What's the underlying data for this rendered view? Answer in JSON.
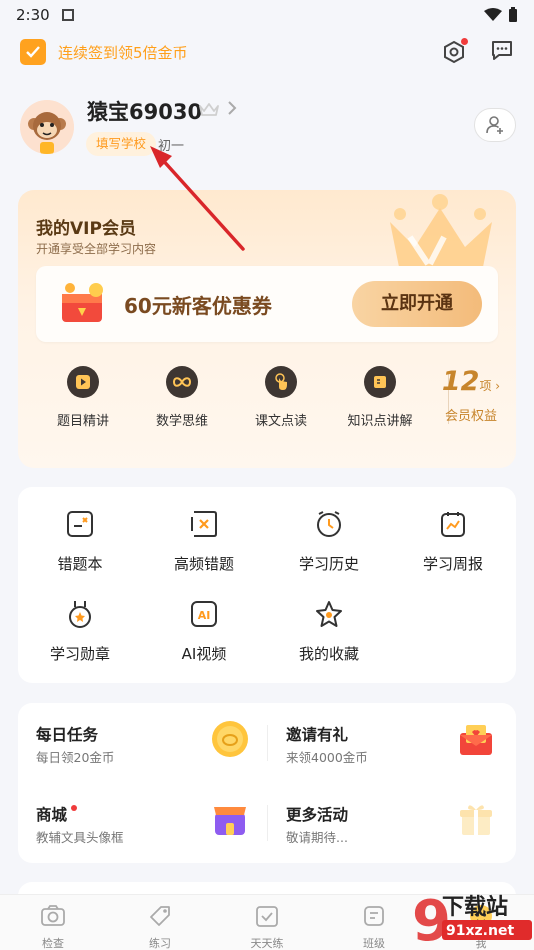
{
  "status_bar": {
    "time": "2:30"
  },
  "top_bar": {
    "checkin_text": "连续签到领5倍金币"
  },
  "profile": {
    "username": "猿宝69030",
    "school_tag": "填写学校",
    "grade": "初一"
  },
  "vip": {
    "title": "我的VIP会员",
    "subtitle": "开通享受全部学习内容",
    "coupon_text": "60元新客优惠券",
    "open_button": "立即开通",
    "features": [
      {
        "label": "题目精讲",
        "icon": "play-icon"
      },
      {
        "label": "数学思维",
        "icon": "infinity-icon"
      },
      {
        "label": "课文点读",
        "icon": "finger-tap-icon"
      },
      {
        "label": "知识点讲解",
        "icon": "book-icon"
      }
    ],
    "benefits": {
      "count": "12",
      "unit": "项",
      "label": "会员权益"
    }
  },
  "tools": [
    {
      "label": "错题本",
      "icon": "wrong-book-icon"
    },
    {
      "label": "高频错题",
      "icon": "frequent-errors-icon"
    },
    {
      "label": "学习历史",
      "icon": "clock-icon"
    },
    {
      "label": "学习周报",
      "icon": "weekly-report-icon"
    },
    {
      "label": "学习勋章",
      "icon": "medal-icon"
    },
    {
      "label": "AI视频",
      "icon": "ai-video-icon"
    },
    {
      "label": "我的收藏",
      "icon": "star-icon"
    }
  ],
  "tasks": [
    {
      "title": "每日任务",
      "subtitle": "每日领20金币",
      "icon": "coin-icon"
    },
    {
      "title": "邀请有礼",
      "subtitle": "来领4000金币",
      "icon": "invite-envelope-icon"
    },
    {
      "title": "商城",
      "subtitle": "教辅文具头像框",
      "icon": "shop-icon"
    },
    {
      "title": "更多活动",
      "subtitle": "敬请期待...",
      "icon": "gift-box-icon"
    }
  ],
  "tab_bar": [
    {
      "label": "检查",
      "icon": "camera-icon"
    },
    {
      "label": "练习",
      "icon": "tag-icon"
    },
    {
      "label": "天天练",
      "icon": "calendar-check-icon"
    },
    {
      "label": "班级",
      "icon": "class-icon"
    },
    {
      "label": "我",
      "icon": "profile-icon"
    }
  ],
  "watermark": {
    "line1": "下载站",
    "line2": "91xz.net"
  },
  "colors": {
    "accent": "#ff9f1a",
    "vip_gold": "#c7852c",
    "vip_button": "#f3bb7a",
    "annotation_arrow": "#d9262a"
  }
}
